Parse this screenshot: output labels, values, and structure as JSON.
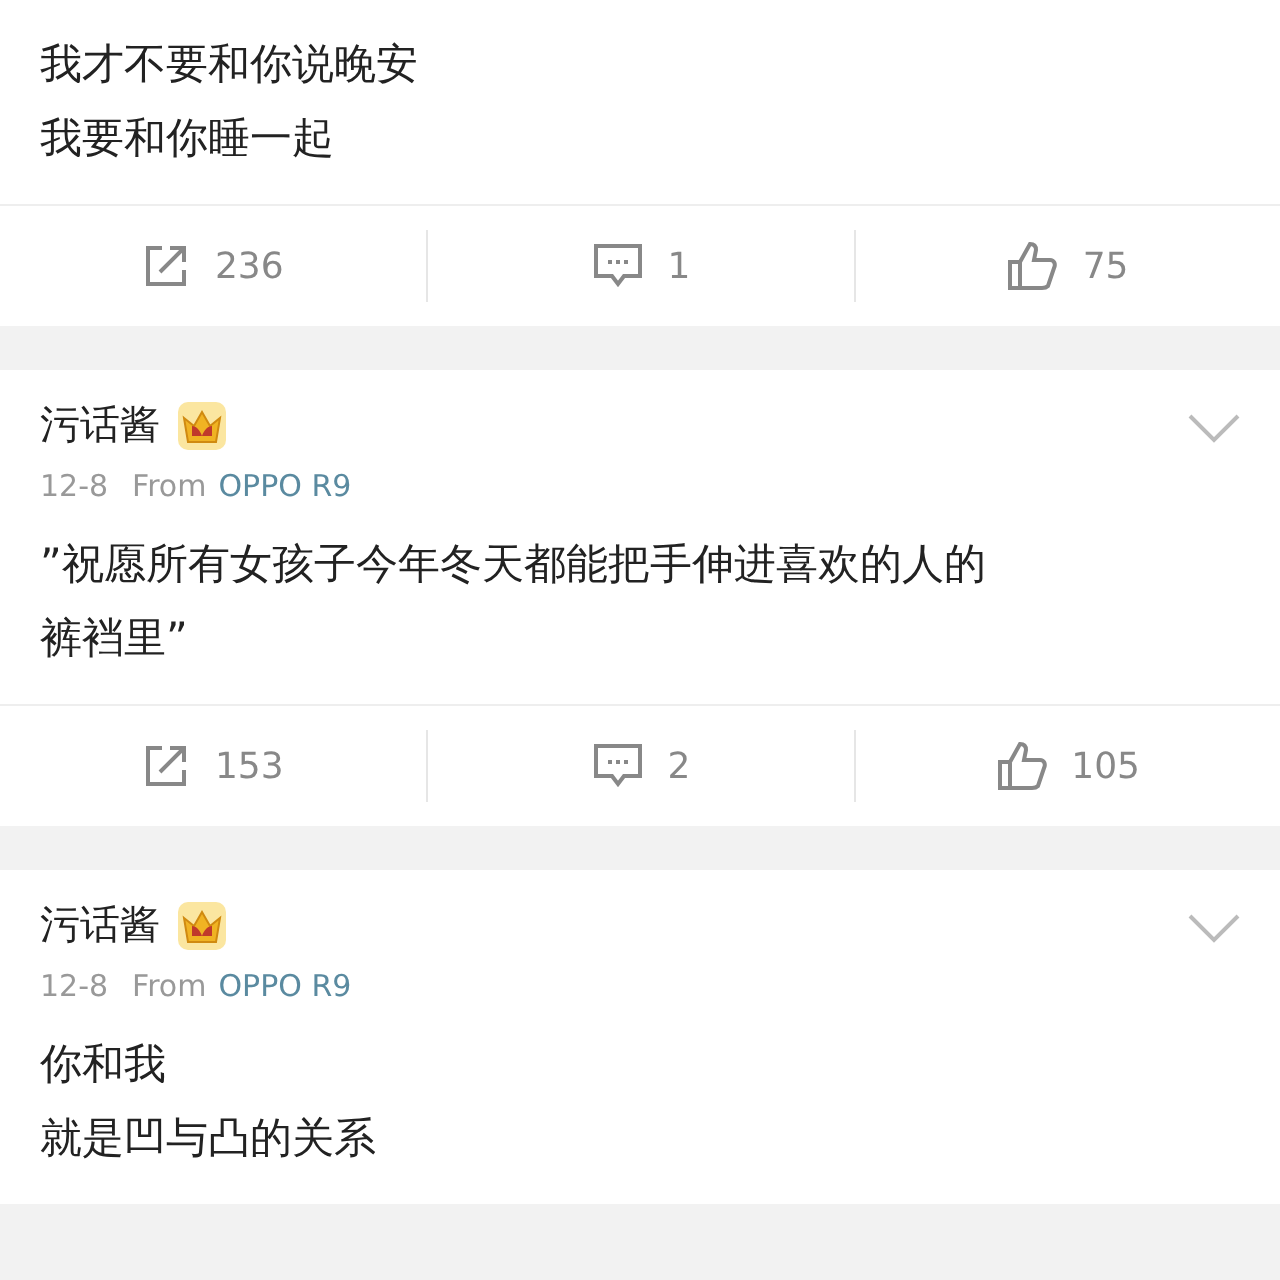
{
  "posts": [
    {
      "lines": [
        "我才不要和你说晚安",
        "我要和你睡一起"
      ],
      "actions": [
        {
          "kind": "repost",
          "count": "236"
        },
        {
          "kind": "comment",
          "count": "1"
        },
        {
          "kind": "like",
          "count": "75"
        }
      ]
    },
    {
      "header": {
        "author": "污话酱",
        "date": "12-8",
        "source_prefix": "From",
        "source": "OPPO R9"
      },
      "lines": [
        "”祝愿所有女孩子今年冬天都能把手伸进喜欢的人的",
        "裤裆里”"
      ],
      "actions": [
        {
          "kind": "repost",
          "count": "153"
        },
        {
          "kind": "comment",
          "count": "2"
        },
        {
          "kind": "like",
          "count": "105"
        }
      ]
    },
    {
      "header": {
        "author": "污话酱",
        "date": "12-8",
        "source_prefix": "From",
        "source": "OPPO R9"
      },
      "lines": [
        "你和我",
        "就是凹与凸的关系"
      ]
    }
  ]
}
